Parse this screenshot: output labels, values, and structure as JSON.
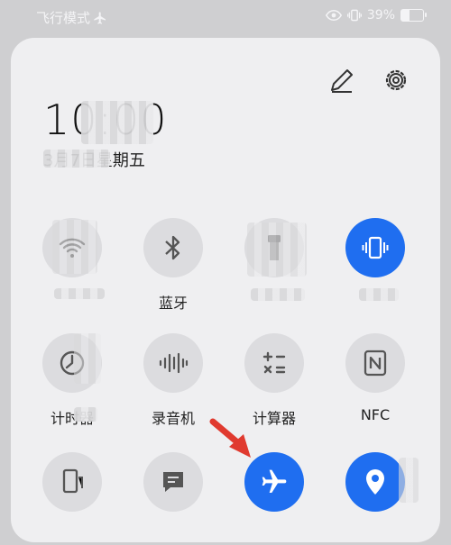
{
  "status_bar": {
    "mode_label": "飞行模式",
    "battery_percent": "39%",
    "battery_level": 0.39
  },
  "header": {
    "time": "10:00",
    "date": "3月7日星期五"
  },
  "tiles": [
    {
      "id": "wifi",
      "label": "",
      "icon": "wifi-icon",
      "active": false
    },
    {
      "id": "bluetooth",
      "label": "蓝牙",
      "icon": "bluetooth-icon",
      "active": false
    },
    {
      "id": "flashlight",
      "label": "",
      "icon": "flashlight-icon",
      "active": false
    },
    {
      "id": "vibrate",
      "label": "",
      "icon": "vibrate-icon",
      "active": true
    },
    {
      "id": "timer",
      "label": "计时器",
      "icon": "timer-icon",
      "active": false
    },
    {
      "id": "recorder",
      "label": "录音机",
      "icon": "waveform-icon",
      "active": false
    },
    {
      "id": "calculator",
      "label": "计算器",
      "icon": "calculator-icon",
      "active": false
    },
    {
      "id": "nfc",
      "label": "NFC",
      "icon": "nfc-icon",
      "active": false
    },
    {
      "id": "phone-link",
      "label": "",
      "icon": "phone-link-icon",
      "active": false
    },
    {
      "id": "notes",
      "label": "",
      "icon": "message-icon",
      "active": false
    },
    {
      "id": "airplane",
      "label": "",
      "icon": "airplane-icon",
      "active": true
    },
    {
      "id": "location",
      "label": "",
      "icon": "location-icon",
      "active": true
    }
  ],
  "colors": {
    "accent": "#1f6ef0",
    "tile_bg": "#dcdcdf",
    "panel_bg": "#efeff1",
    "arrow": "#e03a2f"
  }
}
